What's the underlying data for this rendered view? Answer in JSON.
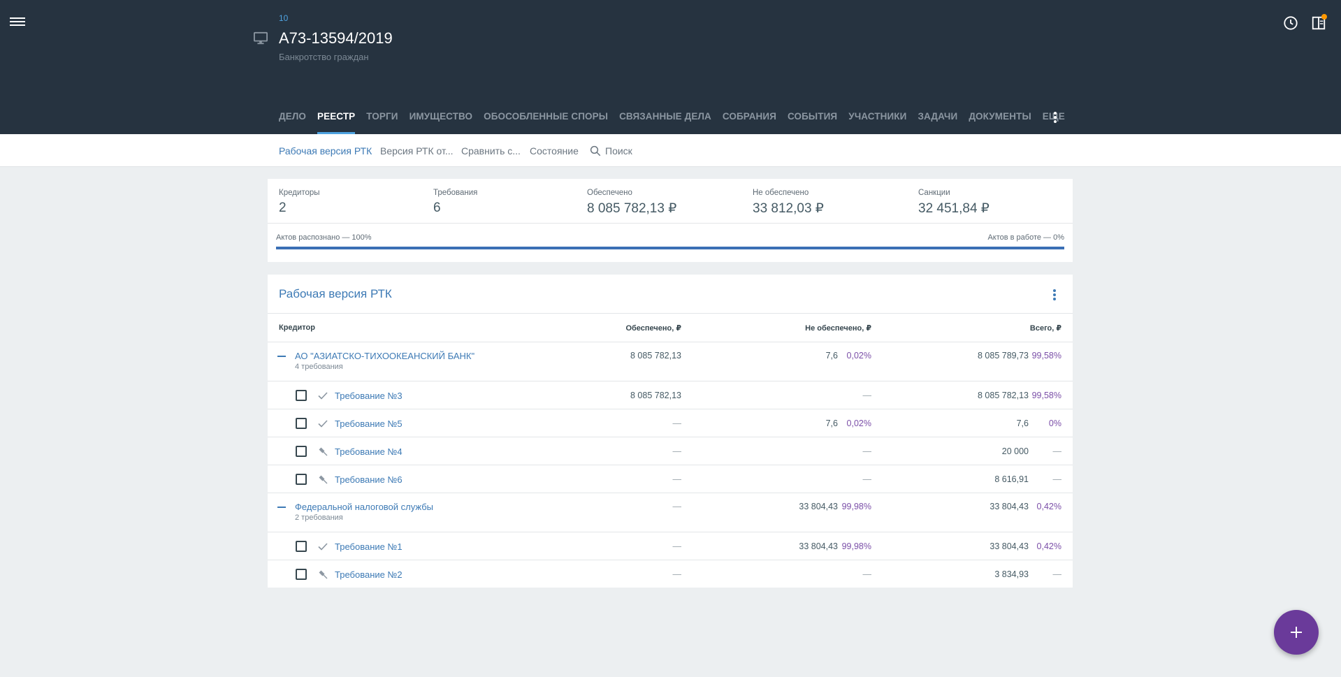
{
  "header": {
    "case_count": "10",
    "case_number": "А73-13594/2019",
    "case_type": "Банкротство граждан",
    "tabs": [
      {
        "label": "ДЕЛО"
      },
      {
        "label": "РЕЕСТР"
      },
      {
        "label": "ТОРГИ"
      },
      {
        "label": "ИМУЩЕСТВО"
      },
      {
        "label": "ОБОСОБЛЕННЫЕ СПОРЫ"
      },
      {
        "label": "СВЯЗАННЫЕ ДЕЛА"
      },
      {
        "label": "СОБРАНИЯ"
      },
      {
        "label": "СОБЫТИЯ"
      },
      {
        "label": "УЧАСТНИКИ"
      },
      {
        "label": "ЗАДАЧИ"
      },
      {
        "label": "ДОКУМЕНТЫ"
      },
      {
        "label": "ЕЩЕ"
      }
    ],
    "active_tab": "РЕЕСТР"
  },
  "subbar": {
    "items": [
      {
        "label": "Рабочая версия РТК"
      },
      {
        "label": "Версия РТК от..."
      },
      {
        "label": "Сравнить с..."
      },
      {
        "label": "Состояние"
      }
    ],
    "search_placeholder": "Поиск"
  },
  "summary": {
    "creditors": {
      "label": "Кредиторы",
      "value": "2"
    },
    "claims": {
      "label": "Требования",
      "value": "6"
    },
    "secured": {
      "label": "Обеспечено",
      "value": "8 085 782,13 ₽"
    },
    "unsecured": {
      "label": "Не обеспечено",
      "value": "33 812,03 ₽"
    },
    "sanctions": {
      "label": "Санкции",
      "value": "32 451,84 ₽"
    },
    "recognized_label": "Актов распознано — 100%",
    "in_work_label": "Актов в работе — 0%",
    "recognized_fraction": 1.0
  },
  "registry": {
    "title": "Рабочая версия РТК",
    "columns": {
      "creditor": "Кредитор",
      "secured": "Обеспечено, ₽",
      "unsecured": "Не обеспечено, ₽",
      "total": "Всего, ₽"
    },
    "groups": [
      {
        "name": "АО \"АЗИАТСКО-ТИХООКЕАНСКИЙ БАНК\"",
        "sub": "4 требования",
        "secured": "8 085 782,13",
        "unsecured": "7,6",
        "unsecured_pct": "0,02%",
        "total": "8 085 789,73",
        "total_pct": "99,58%",
        "claims": [
          {
            "name": "Требование №3",
            "status_icon": "check-icon",
            "secured": "8 085 782,13",
            "unsecured": "—",
            "unsecured_pct": "",
            "total": "8 085 782,13",
            "total_pct": "99,58%"
          },
          {
            "name": "Требование №5",
            "status_icon": "check-icon",
            "secured": "—",
            "unsecured": "7,6",
            "unsecured_pct": "0,02%",
            "total": "7,6",
            "total_pct": "0%"
          },
          {
            "name": "Требование №4",
            "status_icon": "gavel-icon",
            "secured": "—",
            "unsecured": "—",
            "unsecured_pct": "",
            "total": "20 000",
            "total_pct": "—"
          },
          {
            "name": "Требование №6",
            "status_icon": "gavel-icon",
            "secured": "—",
            "unsecured": "—",
            "unsecured_pct": "",
            "total": "8 616,91",
            "total_pct": "—"
          }
        ]
      },
      {
        "name": "Федеральной налоговой службы",
        "sub": "2 требования",
        "secured": "—",
        "unsecured": "33 804,43",
        "unsecured_pct": "99,98%",
        "total": "33 804,43",
        "total_pct": "0,42%",
        "claims": [
          {
            "name": "Требование №1",
            "status_icon": "check-icon",
            "secured": "—",
            "unsecured": "33 804,43",
            "unsecured_pct": "99,98%",
            "total": "33 804,43",
            "total_pct": "0,42%"
          },
          {
            "name": "Требование №2",
            "status_icon": "gavel-icon",
            "secured": "—",
            "unsecured": "—",
            "unsecured_pct": "",
            "total": "3 834,93",
            "total_pct": "—"
          }
        ]
      }
    ]
  },
  "icons": {
    "menu": "menu-icon",
    "case": "monitor-icon",
    "history": "clock-icon",
    "panel": "side-panel-icon",
    "more": "more-vert-icon",
    "search": "search-icon",
    "add": "plus-icon"
  },
  "colors": {
    "header_bg": "#263340",
    "accent": "#4fa3e0",
    "link": "#3d7ab5",
    "percent": "#7b4fa8",
    "fab": "#6a3a9a",
    "notification": "#ff9800"
  }
}
